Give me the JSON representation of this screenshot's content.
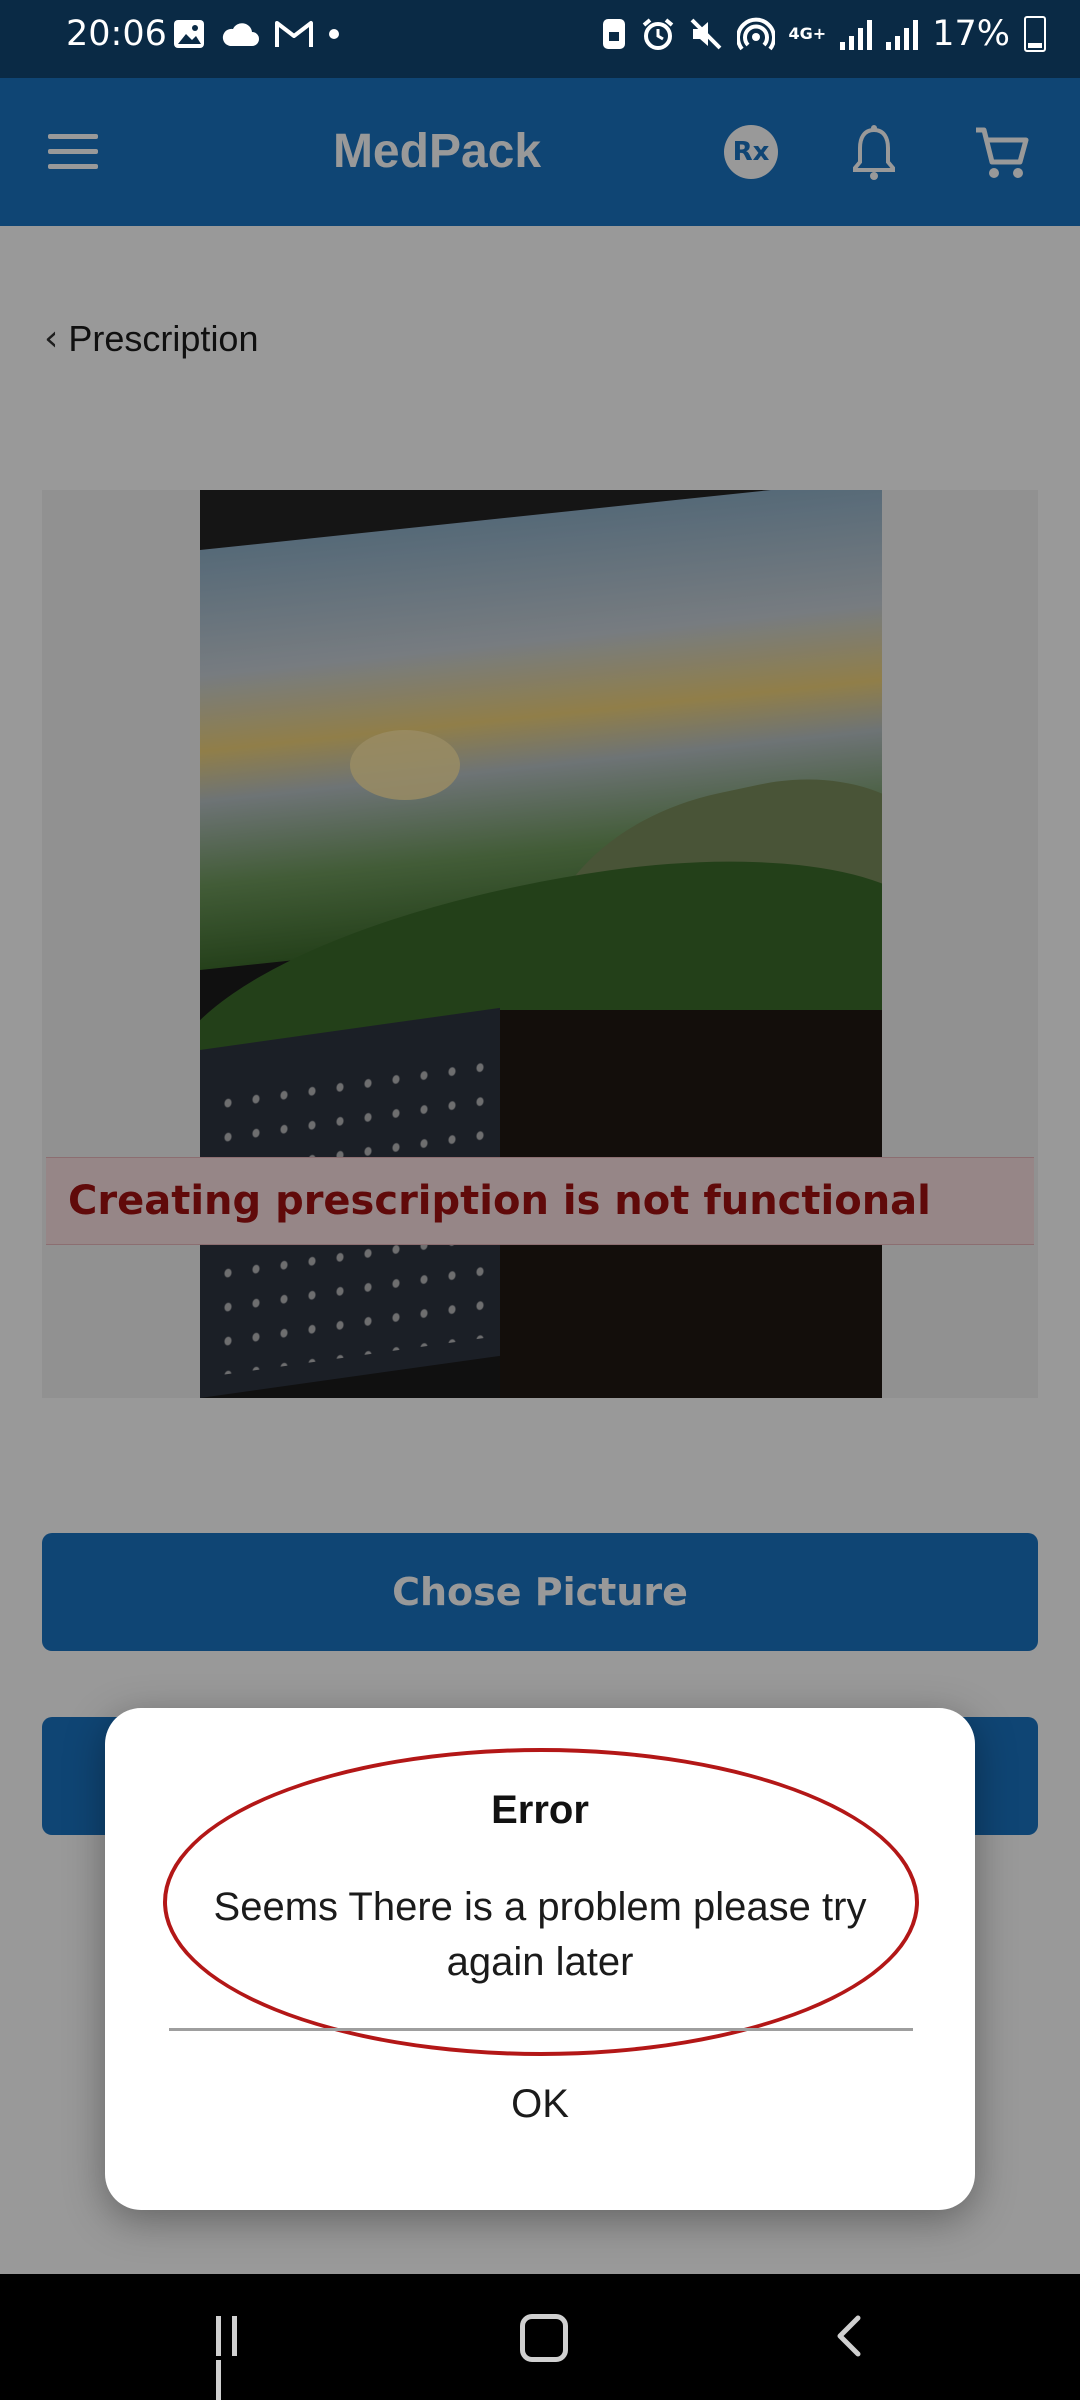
{
  "status_bar": {
    "time": "20:06",
    "left_icons": [
      "gallery-icon",
      "cloud-icon",
      "gmail-icon",
      "dot-icon"
    ],
    "right_icons": [
      "screen-lock-icon",
      "alarm-icon",
      "mute-icon",
      "hotspot-icon",
      "4g-icon",
      "signal-icon",
      "signal-icon",
      "battery-charging-icon"
    ],
    "network": "4G+",
    "battery": "17%"
  },
  "app_bar": {
    "title": "MedPack",
    "rx_label": "Rx",
    "icons": [
      "menu-icon",
      "rx-icon",
      "bell-icon",
      "cart-icon"
    ]
  },
  "page": {
    "back_label": "Prescription",
    "error_banner": "Creating prescription is not functional",
    "buttons": {
      "chose_picture": "Chose Picture",
      "second": ""
    }
  },
  "dialog": {
    "title": "Error",
    "message": "Seems There is a problem please try again later",
    "ok_label": "OK",
    "highlight_color": "#b31717"
  },
  "colors": {
    "primary": "#1a73c2",
    "status_bar": "#0a2a45",
    "error_text": "#a11212",
    "error_bg": "#fbe0e2"
  },
  "nav_bar": {
    "icons": [
      "recents-icon",
      "home-icon",
      "back-icon"
    ]
  }
}
